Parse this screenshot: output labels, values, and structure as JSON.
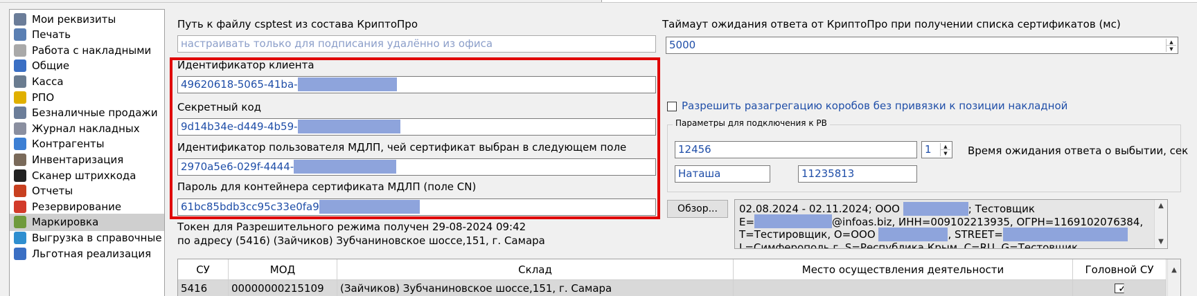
{
  "sidebar": {
    "items": [
      {
        "label": "Мои реквизиты",
        "icon": "gear-icon",
        "color": "#6b7d99"
      },
      {
        "label": "Печать",
        "icon": "printer-icon",
        "color": "#5a7fb3"
      },
      {
        "label": "Работа с накладными",
        "icon": "document-icon",
        "color": "#a9a9a9"
      },
      {
        "label": "Общие",
        "icon": "settings-icon",
        "color": "#3a6fc4"
      },
      {
        "label": "Касса",
        "icon": "cash-register-icon",
        "color": "#6a7c90"
      },
      {
        "label": "РПО",
        "icon": "envelope-icon",
        "color": "#e0b000"
      },
      {
        "label": "Безналичные продажи",
        "icon": "gear-icon",
        "color": "#6b7d99"
      },
      {
        "label": "Журнал накладных",
        "icon": "journal-icon",
        "color": "#8a8fa0"
      },
      {
        "label": "Контрагенты",
        "icon": "contacts-icon",
        "color": "#3c7fd4"
      },
      {
        "label": "Инвентаризация",
        "icon": "inventory-icon",
        "color": "#7a6a5a"
      },
      {
        "label": "Сканер штрихкода",
        "icon": "barcode-icon",
        "color": "#222222"
      },
      {
        "label": "Отчеты",
        "icon": "report-icon",
        "color": "#c84020"
      },
      {
        "label": "Резервирование",
        "icon": "power-icon",
        "color": "#d23a2a"
      },
      {
        "label": "Маркировка",
        "icon": "tag-icon",
        "color": "#6f9a3c"
      },
      {
        "label": "Выгрузка в справочные",
        "icon": "globe-icon",
        "color": "#2f8fd0"
      },
      {
        "label": "Льготная реализация",
        "icon": "folder-icon",
        "color": "#3a6fc4"
      }
    ],
    "active_index": 13
  },
  "cryptopro": {
    "path_label": "Путь к файлу csptest из состава КриптоПро",
    "path_placeholder": "настраивать только для подписания удалённо из офиса",
    "timeout_label": "Таймаут ожидания ответа от КриптоПро при получении списка сертификатов (мс)",
    "timeout_value": "5000"
  },
  "credentials": {
    "client_id_label": "Идентификатор клиента",
    "client_id_value": "49620618-5065-41ba-",
    "secret_label": "Секретный код",
    "secret_value": "9d14b34e-d449-4b59-",
    "mdlp_user_label": "Идентификатор пользователя МДЛП, чей сертификат выбран в следующем поле",
    "mdlp_user_value": "2970a5e6-029f-4444-",
    "container_pass_label": "Пароль для контейнера сертификата МДЛП (поле CN)",
    "container_pass_value": "61bc85bdb3cc95c33e0fa9"
  },
  "token": {
    "line1": "Токен для Разрешительного режима получен 29-08-2024 09:42",
    "line2": "по адресу (5416) (Зайчиков) Зубчаниновское шоссе,151, г. Самара"
  },
  "disaggregation": {
    "label": "Разрешить разагрегацию коробов без привязки к позиции накладной",
    "checked": false
  },
  "rv": {
    "group_title": "Параметры для подключения к РВ",
    "field1": "12456",
    "spin_value": "1",
    "wait_label": "Время ожидания ответа о выбытии, сек",
    "user_value": "Наташа",
    "code_value": "11235813"
  },
  "certificate": {
    "browse_label": "Обзор...",
    "line1_a": "02.08.2024 - 02.11.2024; ООО",
    "line1_b": "; Тестовщик",
    "line2_a": "E=",
    "line2_b": "@infoas.biz, ИНН=009102213935, ОГРН=1169102076384,",
    "line3_a": "T=Тестировщик, O=ООО",
    "line3_b": ", STREET=",
    "line4": "L=Симферополь г, S=Республика Крым, C=RU, G=Тестовщик"
  },
  "table": {
    "columns": [
      "СУ",
      "МОД",
      "Склад",
      "Место осуществления деятельности",
      "Головной СУ"
    ],
    "rows": [
      {
        "su": "5416",
        "mod": "00000000215109",
        "sklad": "(Зайчиков) Зубчаниновское шоссе,151, г. Самара",
        "place": "",
        "head": true
      }
    ]
  }
}
